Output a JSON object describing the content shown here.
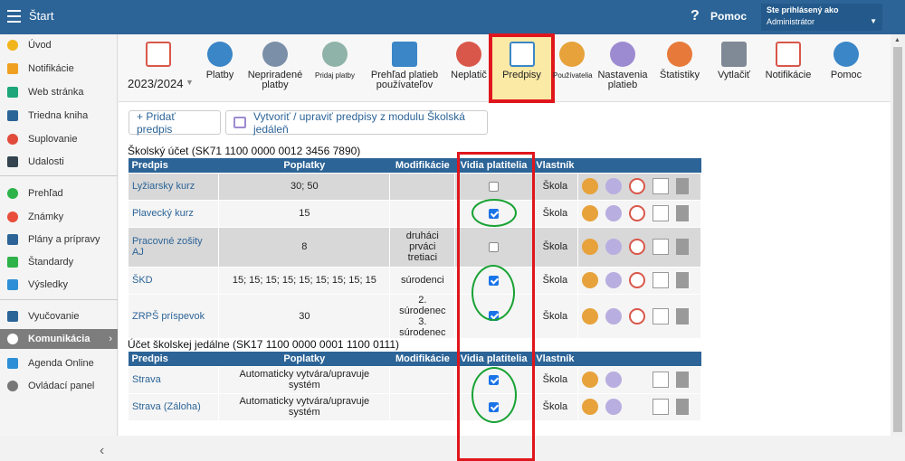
{
  "topbar": {
    "title": "Štart",
    "help_label": "Pomoc",
    "user_line1": "Ste prihlásený ako",
    "user_line2": "Administrátor"
  },
  "sidebar": {
    "items": [
      {
        "label": "Úvod",
        "color": "#f2b519"
      },
      {
        "label": "Notifikácie",
        "color": "#f0a021"
      },
      {
        "label": "Web stránka",
        "color": "#1ca67a"
      },
      {
        "label": "Triedna kniha",
        "color": "#2c6497"
      },
      {
        "label": "Suplovanie",
        "color": "#e24b3b"
      },
      {
        "label": "Udalosti",
        "color": "#33434f"
      },
      {
        "label": "Prehľad",
        "color": "#2eb24a"
      },
      {
        "label": "Známky",
        "color": "#e84e3b"
      },
      {
        "label": "Plány a prípravy",
        "color": "#2c6497"
      },
      {
        "label": "Štandardy",
        "color": "#2eb24a"
      },
      {
        "label": "Výsledky",
        "color": "#2c8fd6"
      },
      {
        "label": "Vyučovanie",
        "color": "#2c6497"
      },
      {
        "label": "Komunikácia",
        "color": "#ffffff"
      },
      {
        "label": "Agenda Online",
        "color": "#2c8fd6"
      },
      {
        "label": "Ovládací panel",
        "color": "#777777"
      }
    ]
  },
  "toolbar": {
    "year": "2023/2024",
    "items": [
      {
        "label": "Platby",
        "color": "#3b86c7"
      },
      {
        "label": "Nepriradené platby",
        "color": "#7b8fa8"
      },
      {
        "label": "Pridaj platby",
        "color": "#8fb3a8"
      },
      {
        "label": "Prehľad platieb používateľov",
        "color": "#3b86c7"
      },
      {
        "label": "Neplatič",
        "color": "#d9574a"
      },
      {
        "label": "Predpisy",
        "color": "#3b86c7"
      },
      {
        "label": "Používatelia",
        "color": "#e7a23b"
      },
      {
        "label": "Nastavenia platieb",
        "color": "#9d8bd1"
      },
      {
        "label": "Štatistiky",
        "color": "#e77a3b"
      },
      {
        "label": "Vytlačiť",
        "color": "#808a96"
      },
      {
        "label": "Notifikácie",
        "color": "#d9574a"
      },
      {
        "label": "Pomoc",
        "color": "#3b86c7"
      }
    ]
  },
  "actions": {
    "add_label": "+ Pridať predpis",
    "canteen_label": "Vytvoriť / upraviť predpisy z modulu Školská jedáleň"
  },
  "table1": {
    "title": "Školský účet (SK71 1100 0000 0012 3456 7890)",
    "headers": [
      "Predpis",
      "Poplatky",
      "Modifikácie",
      "Vidia platitelia",
      "Vlastník"
    ],
    "rows": [
      {
        "name": "Lyžiarsky kurz",
        "fees": "30; 50",
        "mod1": "",
        "mod2": "",
        "mod3": "",
        "checked": false,
        "owner": "Škola"
      },
      {
        "name": "Plavecký kurz",
        "fees": "15",
        "mod1": "",
        "mod2": "",
        "mod3": "",
        "checked": true,
        "owner": "Škola"
      },
      {
        "name": "Pracovné zošity AJ",
        "fees": "8",
        "mod1": "druháci",
        "mod2": "prváci",
        "mod3": "tretiaci",
        "checked": false,
        "owner": "Škola"
      },
      {
        "name": "ŠKD",
        "fees": "15; 15; 15; 15; 15; 15; 15; 15; 15",
        "mod1": "súrodenci",
        "mod2": "",
        "mod3": "",
        "checked": true,
        "owner": "Škola"
      },
      {
        "name": "ZRPŠ príspevok",
        "fees": "30",
        "mod1": "2. súrodenec",
        "mod2": "3. súrodenec",
        "mod3": "",
        "checked": true,
        "owner": "Škola"
      }
    ]
  },
  "table2": {
    "title": "Účet školskej jedálne (SK17 1100 0000 0001 1100 0111)",
    "headers": [
      "Predpis",
      "Poplatky",
      "Modifikácie",
      "Vidia platitelia",
      "Vlastník"
    ],
    "rows": [
      {
        "name": "Strava",
        "fees": "Automaticky vytvára/upravuje systém",
        "checked": true,
        "owner": "Škola"
      },
      {
        "name": "Strava (Záloha)",
        "fees": "Automaticky vytvára/upravuje systém",
        "checked": true,
        "owner": "Škola"
      }
    ]
  }
}
